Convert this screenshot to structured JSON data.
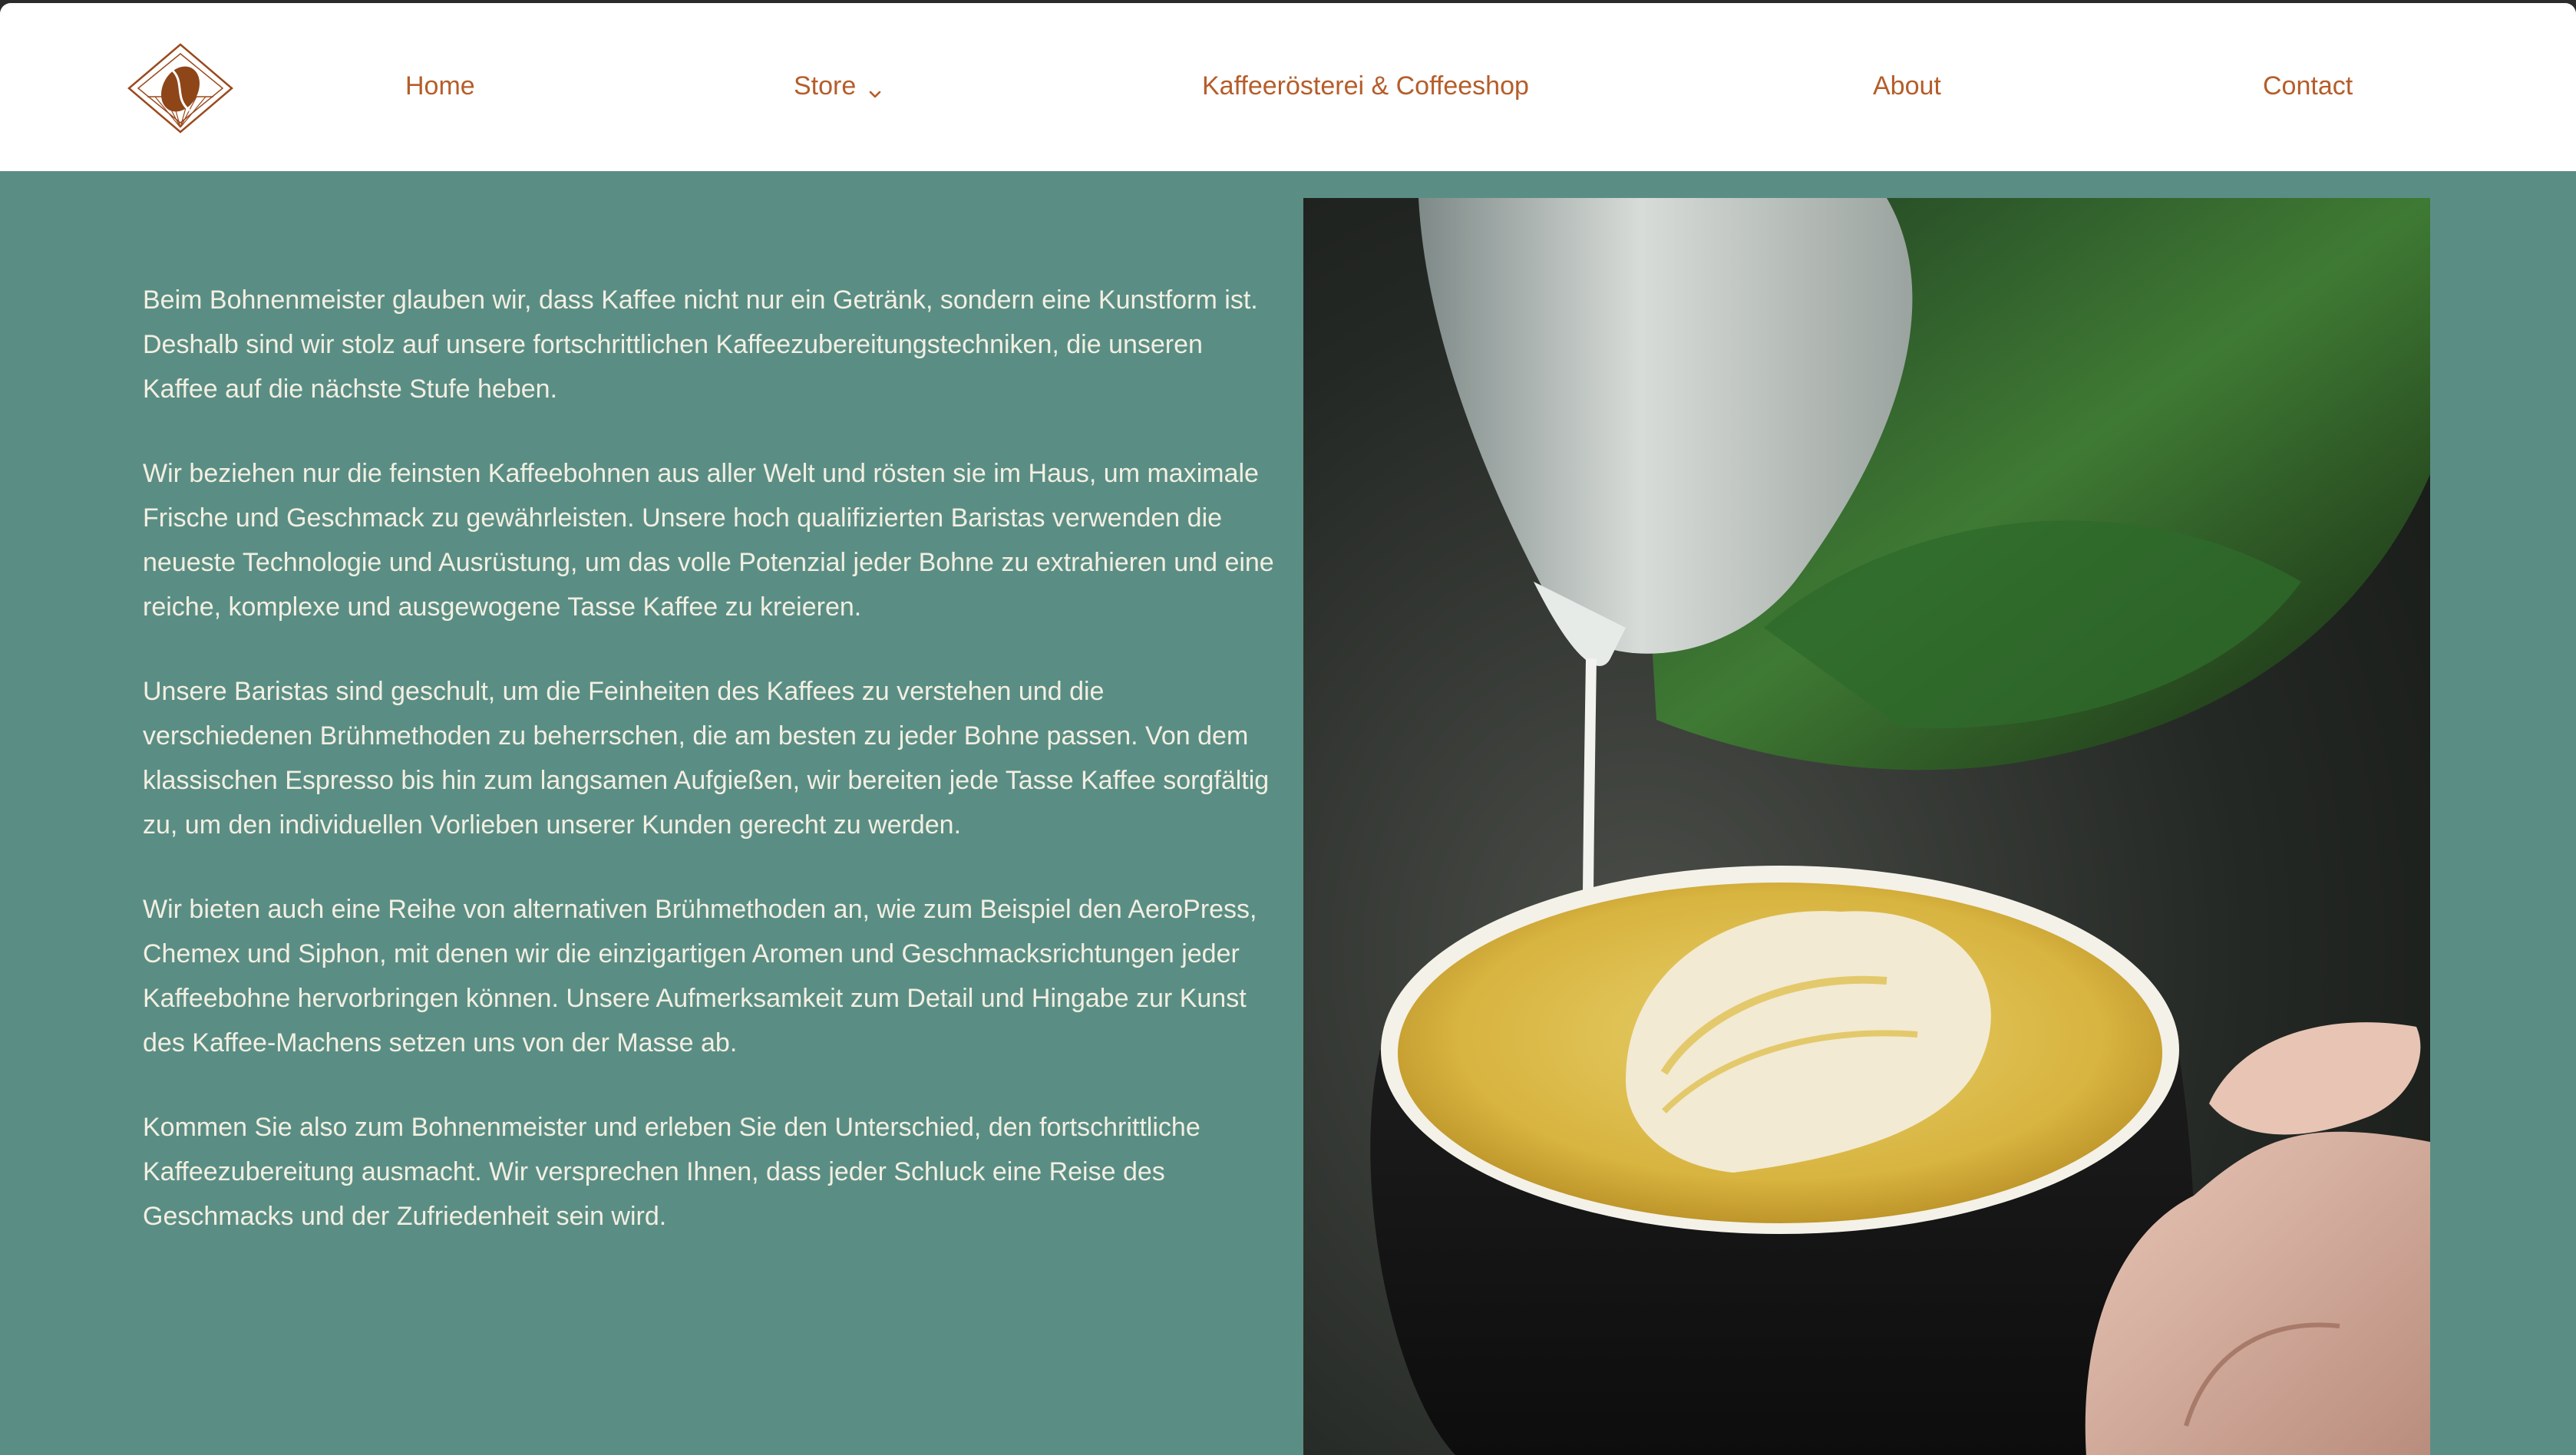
{
  "nav": {
    "logo_icon": "coffee-bean-diamond-logo",
    "home": "Home",
    "store": "Store",
    "roastery": "Kaffeerösterei & Coffeeshop",
    "about": "About",
    "contact": "Contact"
  },
  "main": {
    "paragraphs": [
      "Beim Bohnenmeister glauben wir, dass Kaffee nicht nur ein Getränk, sondern eine Kunstform ist. Deshalb sind wir stolz auf unsere fortschrittlichen Kaffeezubereitungstechniken, die unseren Kaffee auf die nächste Stufe heben.",
      "Wir beziehen nur die feinsten Kaffeebohnen aus aller Welt und rösten sie im Haus, um maximale Frische und Geschmack zu gewährleisten. Unsere hoch qualifizierten Baristas verwenden die neueste Technologie und Ausrüstung, um das volle Potenzial jeder Bohne zu extrahieren und eine reiche, komplexe und ausgewogene Tasse Kaffee zu kreieren.",
      "Unsere Baristas sind geschult, um die Feinheiten des Kaffees zu verstehen und die verschiedenen Brühmethoden zu beherrschen, die am besten zu jeder Bohne passen. Von dem klassischen Espresso bis hin zum langsamen Aufgießen, wir bereiten jede Tasse Kaffee sorgfältig zu, um den individuellen Vorlieben unserer Kunden gerecht zu werden.",
      "Wir bieten auch eine Reihe von alternativen Brühmethoden an, wie zum Beispiel den AeroPress, Chemex und Siphon, mit denen wir die einzigartigen Aromen und Geschmacksrichtungen jeder Kaffeebohne hervorbringen können. Unsere Aufmerksamkeit zum Detail und Hingabe zur Kunst des Kaffee-Machens setzen uns von der Masse ab.",
      "Kommen Sie also zum Bohnenmeister und erleben Sie den Unterschied, den fortschrittliche Kaffeezubereitung ausmacht. Wir versprechen Ihnen, dass jeder Schluck eine Reise des Geschmacks und der Zufriedenheit sein wird."
    ]
  },
  "colors": {
    "accent": "#b55d2a",
    "background": "#5a8e84",
    "text": "#f3efe2"
  }
}
